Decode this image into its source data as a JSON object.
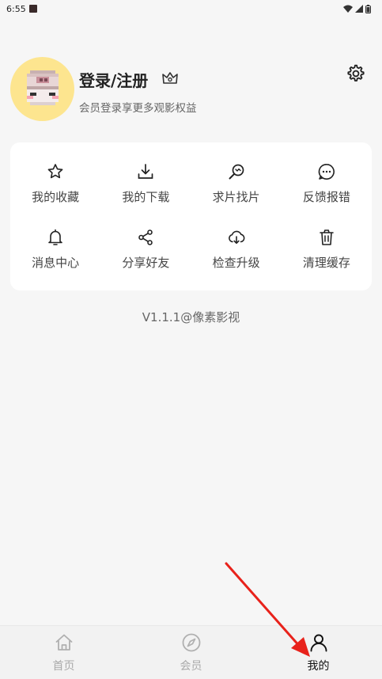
{
  "status_bar": {
    "time": "6:55"
  },
  "profile": {
    "title": "登录/注册",
    "subtitle": "会员登录享更多观影权益"
  },
  "menu": [
    {
      "label": "我的收藏",
      "icon": "star-icon"
    },
    {
      "label": "我的下载",
      "icon": "download-icon"
    },
    {
      "label": "求片找片",
      "icon": "search-film-icon"
    },
    {
      "label": "反馈报错",
      "icon": "chat-bubble-icon"
    },
    {
      "label": "消息中心",
      "icon": "bell-icon"
    },
    {
      "label": "分享好友",
      "icon": "share-icon"
    },
    {
      "label": "检查升级",
      "icon": "cloud-download-icon"
    },
    {
      "label": "清理缓存",
      "icon": "trash-icon"
    }
  ],
  "version": "V1.1.1@像素影视",
  "tabs": [
    {
      "label": "首页",
      "icon": "home-icon",
      "active": false
    },
    {
      "label": "会员",
      "icon": "compass-icon",
      "active": false
    },
    {
      "label": "我的",
      "icon": "user-icon",
      "active": true
    }
  ],
  "colors": {
    "background": "#f6f6f6",
    "avatar_bg": "#fde58f",
    "annotation_arrow": "#e8221b"
  }
}
